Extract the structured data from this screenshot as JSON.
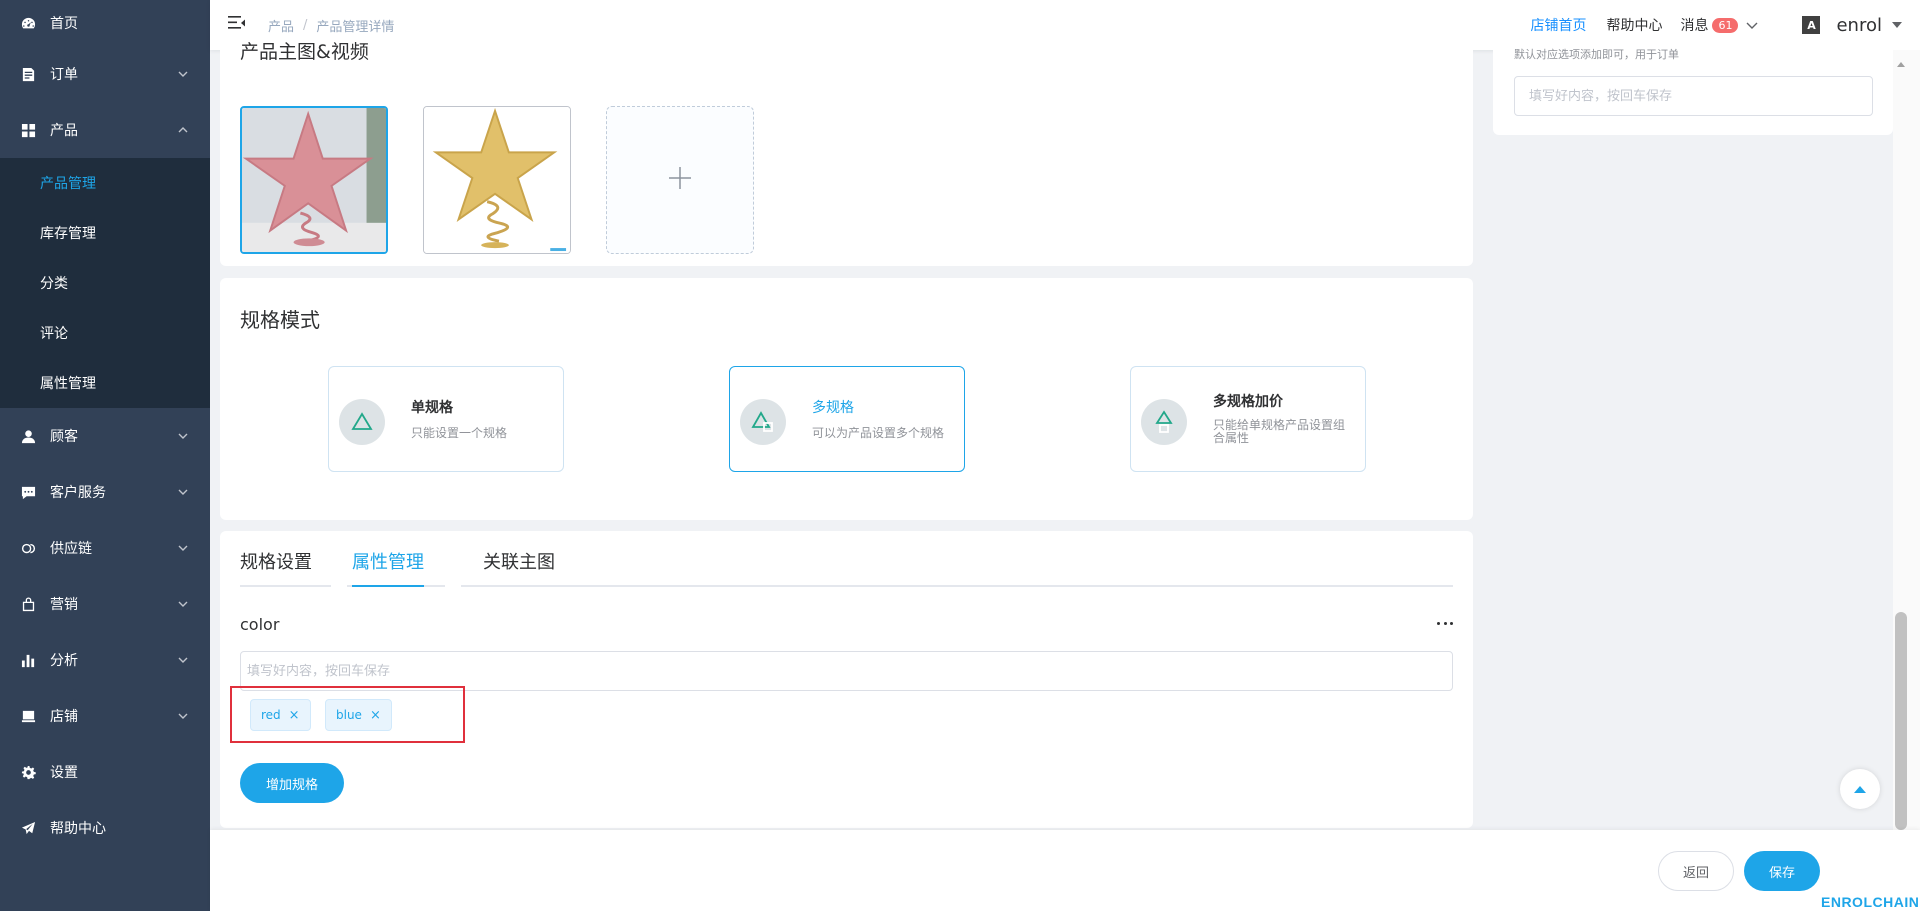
{
  "colors": {
    "accent": "#1ea5e8",
    "sidebar_bg": "#324157",
    "submenu_bg": "#1f2d3d",
    "highlight": "#e0303c",
    "badge": "#f56c6c"
  },
  "sidebar": {
    "items": [
      {
        "label": "首页",
        "icon": "dashboard-icon",
        "has_chevron": false
      },
      {
        "label": "订单",
        "icon": "order-icon",
        "has_chevron": true,
        "chevron": "down"
      },
      {
        "label": "产品",
        "icon": "grid-icon",
        "has_chevron": true,
        "chevron": "up",
        "expanded": true
      },
      {
        "label": "顾客",
        "icon": "user-icon",
        "has_chevron": true,
        "chevron": "down"
      },
      {
        "label": "客户服务",
        "icon": "chat-icon",
        "has_chevron": true,
        "chevron": "down"
      },
      {
        "label": "供应链",
        "icon": "link-icon",
        "has_chevron": true,
        "chevron": "down"
      },
      {
        "label": "营销",
        "icon": "bag-icon",
        "has_chevron": true,
        "chevron": "down"
      },
      {
        "label": "分析",
        "icon": "bar-chart-icon",
        "has_chevron": true,
        "chevron": "down"
      },
      {
        "label": "店铺",
        "icon": "store-icon",
        "has_chevron": true,
        "chevron": "down"
      },
      {
        "label": "设置",
        "icon": "gear-icon",
        "has_chevron": false
      },
      {
        "label": "帮助中心",
        "icon": "send-icon",
        "has_chevron": false
      }
    ],
    "product_submenu": [
      {
        "label": "产品管理",
        "active": true
      },
      {
        "label": "库存管理",
        "active": false
      },
      {
        "label": "分类",
        "active": false
      },
      {
        "label": "评论",
        "active": false
      },
      {
        "label": "属性管理",
        "active": false
      }
    ]
  },
  "header": {
    "breadcrumb": [
      "产品",
      "产品管理详情"
    ],
    "breadcrumb_sep": "/",
    "store_home": "店铺首页",
    "help_center": "帮助中心",
    "messages": "消息",
    "message_count": "61",
    "lang_icon_text": "A",
    "user_name": "enrol"
  },
  "images_section": {
    "title": "产品主图&视频",
    "images": [
      {
        "name": "pink-star-tree-topper",
        "selected": true
      },
      {
        "name": "gold-star-tree-topper",
        "selected": false
      }
    ],
    "upload_icon": "plus-icon"
  },
  "spec_mode": {
    "title": "规格模式",
    "options": [
      {
        "name": "单规格",
        "desc": "只能设置一个规格",
        "active": false
      },
      {
        "name": "多规格",
        "desc": "可以为产品设置多个规格",
        "active": true
      },
      {
        "name": "多规格加价",
        "desc": "只能给单规格产品设置组合属性",
        "active": false
      }
    ]
  },
  "attr_panel": {
    "tabs": [
      {
        "label": "规格设置",
        "active": false
      },
      {
        "label": "属性管理",
        "active": true
      },
      {
        "label": "关联主图",
        "active": false
      }
    ],
    "attribute_name": "color",
    "input_placeholder": "填写好内容，按回车保存",
    "tags": [
      "red",
      "blue"
    ],
    "add_button": "增加规格"
  },
  "right_panel": {
    "cutoff_text": "默认对应选项添加即可，用于订单",
    "input_placeholder": "填写好内容，按回车保存"
  },
  "footer": {
    "back_label": "返回",
    "save_label": "保存",
    "brand": "ENROLCHAIN"
  }
}
